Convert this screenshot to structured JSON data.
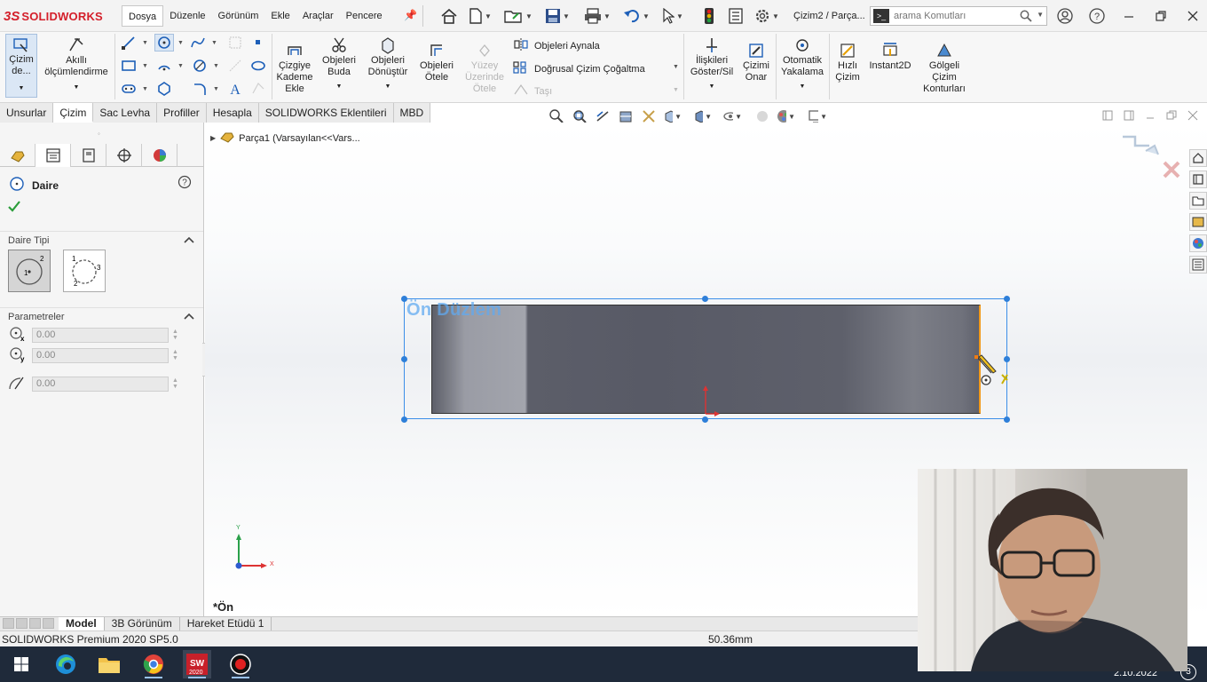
{
  "app": {
    "logo_ds": "3S",
    "logo_text": "SOLIDWORKS",
    "document_title": "Çizim2 / Parça...",
    "menu": [
      "Dosya",
      "Düzenle",
      "Görünüm",
      "Ekle",
      "Araçlar",
      "Pencere"
    ],
    "search_placeholder": "arama Komutları"
  },
  "ribbon": {
    "sketch": "Çizim de...",
    "smart_dim_1": "Akıllı",
    "smart_dim_2": "ölçümlendirme",
    "offset_1": "Çizgiye",
    "offset_2": "Kademe",
    "offset_3": "Ekle",
    "trim_1": "Objeleri",
    "trim_2": "Buda",
    "convert_1": "Objeleri",
    "convert_2": "Dönüştür",
    "offset_ent_1": "Objeleri",
    "offset_ent_2": "Ötele",
    "surface_1": "Yüzey",
    "surface_2": "Üzerinde",
    "surface_3": "Ötele",
    "mirror": "Objeleri Aynala",
    "linear_pattern": "Doğrusal Çizim Çoğaltma",
    "move": "Taşı",
    "relations_1": "İlişkileri",
    "relations_2": "Göster/Sil",
    "repair_1": "Çizimi",
    "repair_2": "Onar",
    "snap_1": "Otomatik",
    "snap_2": "Yakalama",
    "rapid_1": "Hızlı",
    "rapid_2": "Çizim",
    "instant2d": "Instant2D",
    "shaded_1": "Gölgeli",
    "shaded_2": "Çizim",
    "shaded_3": "Konturları"
  },
  "tabs": [
    "Unsurlar",
    "Çizim",
    "Sac Levha",
    "Profiller",
    "Hesapla",
    "SOLIDWORKS Eklentileri",
    "MBD"
  ],
  "panel": {
    "title": "Daire",
    "group_type": "Daire Tipi",
    "group_params": "Parametreler",
    "x_value": "0.00",
    "y_value": "0.00",
    "r_value": "0.00"
  },
  "canvas": {
    "tree_label": "Parça1  (Varsayılan<<Vars...",
    "plane_label": "Ön Düzlem",
    "view_name": "*Ön",
    "axis_x": "X",
    "axis_y": "Y"
  },
  "bottom_tabs": [
    "Model",
    "3B Görünüm",
    "Hareket Etüdü 1"
  ],
  "status": {
    "left": "SOLIDWORKS Premium 2020 SP5.0",
    "measure": "50.36mm"
  },
  "taskbar": {
    "sw_badge": "2020",
    "clock": "2.10.2022",
    "notifications": "3"
  }
}
